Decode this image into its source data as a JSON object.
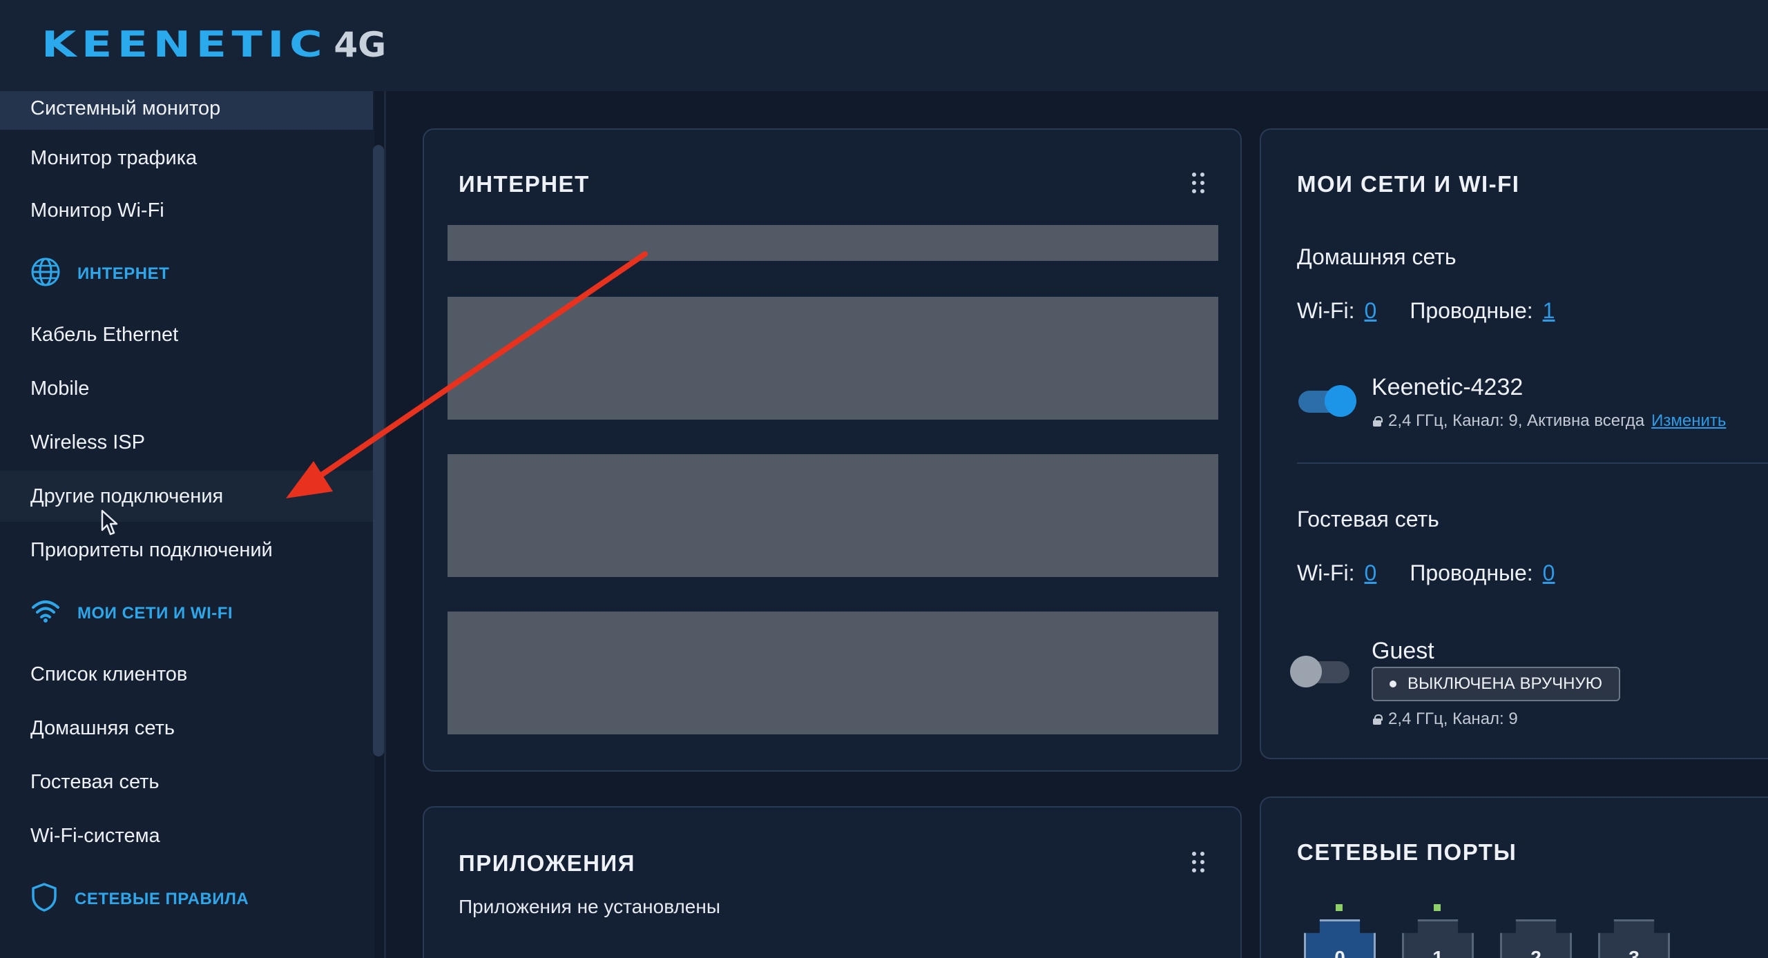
{
  "header": {
    "brand": "KEENETIC",
    "model": "4G"
  },
  "sidebar": {
    "items_top": [
      {
        "label": "Системный монитор",
        "selected": true
      },
      {
        "label": "Монитор трафика"
      },
      {
        "label": "Монитор Wi-Fi"
      }
    ],
    "sections": [
      {
        "title": "ИНТЕРНЕТ",
        "icon": "globe-icon",
        "items": [
          {
            "label": "Кабель Ethernet"
          },
          {
            "label": "Mobile"
          },
          {
            "label": "Wireless ISP"
          },
          {
            "label": "Другие подключения",
            "hovered": true
          },
          {
            "label": "Приоритеты подключений"
          }
        ]
      },
      {
        "title": "МОИ СЕТИ И WI-FI",
        "icon": "wifi-icon",
        "items": [
          {
            "label": "Список клиентов"
          },
          {
            "label": "Домашняя сеть"
          },
          {
            "label": "Гостевая сеть"
          },
          {
            "label": "Wi-Fi-система"
          }
        ]
      },
      {
        "title": "СЕТЕВЫЕ ПРАВИЛА",
        "icon": "shield-icon",
        "items": []
      }
    ]
  },
  "internet_card": {
    "title": "ИНТЕРНЕТ",
    "state": "loading"
  },
  "apps_card": {
    "title": "ПРИЛОЖЕНИЯ",
    "empty_text": "Приложения не установлены"
  },
  "networks_card": {
    "title": "МОИ СЕТИ И WI-FI",
    "home": {
      "title": "Домашняя сеть",
      "wifi_label": "Wi-Fi:",
      "wifi_count": "0",
      "wired_label": "Проводные:",
      "wired_count": "1",
      "ssid": "Keenetic-4232",
      "enabled": true,
      "details": "2,4 ГГц,  Канал: 9, Активна всегда",
      "edit_link": "Изменить"
    },
    "guest": {
      "title": "Гостевая сеть",
      "wifi_label": "Wi-Fi:",
      "wifi_count": "0",
      "wired_label": "Проводные:",
      "wired_count": "0",
      "ssid": "Guest",
      "enabled": false,
      "status_badge": "ВЫКЛЮЧЕНА ВРУЧНУЮ",
      "details": "2,4 ГГц,  Канал: 9"
    }
  },
  "ports_card": {
    "title": "СЕТЕВЫЕ ПОРТЫ",
    "ports": [
      {
        "label": "0",
        "active": true,
        "link": true
      },
      {
        "label": "1",
        "active": false,
        "link": true
      },
      {
        "label": "2",
        "active": false,
        "link": false
      },
      {
        "label": "3",
        "active": false,
        "link": false
      }
    ]
  },
  "colors": {
    "accent": "#2aa9ec",
    "annotation_arrow": "#e8321e",
    "background": "#101a2b"
  }
}
